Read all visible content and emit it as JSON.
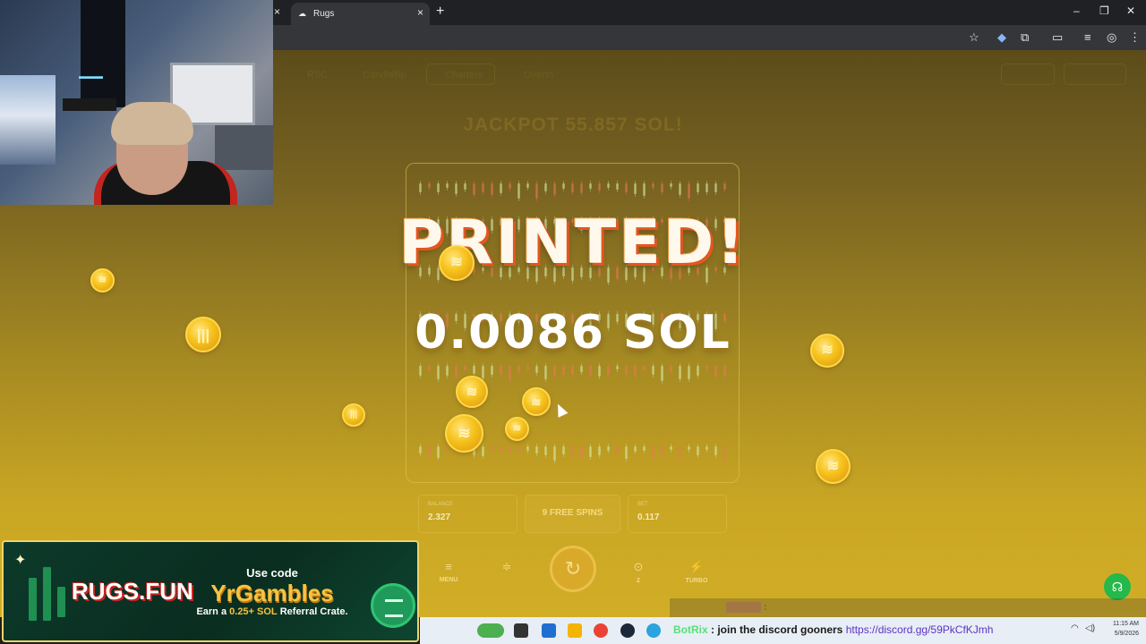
{
  "browser": {
    "tab_title": "Rugs",
    "new_tab_glyph": "+",
    "close_glyph": "×",
    "window_controls": [
      "–",
      "❐",
      "✕"
    ],
    "toolbar_icons": [
      "star-icon",
      "extension-color-icon",
      "puzzle-icon",
      "media-icon",
      "playlist-icon",
      "profile-icon",
      "more-icon"
    ]
  },
  "site": {
    "nav": [
      "RSC",
      "Candleflip",
      "Charters",
      "Overtn"
    ],
    "jackpot": "JACKPOT 55.857 SOL!",
    "balance_label": "BALANCE",
    "balance_value": "2.327",
    "free_spins": "9 FREE SPINS",
    "bet_label": "BET",
    "bet_value": "0.117",
    "controls": {
      "menu": "MENU",
      "turbo": "TURBO",
      "spins_count": "2"
    }
  },
  "overlay": {
    "headline": "PRINTED!",
    "amount": "0.0086 SOL"
  },
  "promo_banner": {
    "logo": "RUGS.FUN",
    "use_code": "Use code",
    "code": "YrGambles",
    "earn_prefix": "Earn a",
    "earn_amount": "0.25+ SOL",
    "earn_suffix": "Referral Crate."
  },
  "chat": {
    "user": "BotRix",
    "message": "join the discord gooners",
    "link": "https://discord.gg/59PkCfKJmh"
  },
  "taskbar": {
    "time": "11:15 AM",
    "date": "5/9/2026"
  },
  "colors": {
    "accent_gold": "#d2ae27",
    "printed_shadow": "#e3571f",
    "banner_green": "#0c3a2a",
    "chat_user": "#58e07d",
    "help_button": "#25b84a"
  }
}
